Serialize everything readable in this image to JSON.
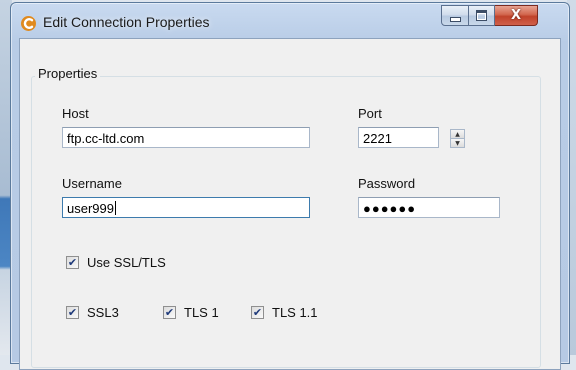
{
  "window": {
    "title": "Edit Connection Properties",
    "app_icon": "app-logo-icon",
    "buttons": {
      "minimize": "minimize-icon",
      "maximize": "maximize-icon",
      "close": "close-icon"
    },
    "close_glyph": "X"
  },
  "group": {
    "legend": "Properties"
  },
  "host": {
    "label": "Host",
    "value": "ftp.cc-ltd.com"
  },
  "port": {
    "label": "Port",
    "value": "2221",
    "up": "▲",
    "down": "▼"
  },
  "username": {
    "label": "Username",
    "value": "user999"
  },
  "password": {
    "label": "Password",
    "masked": "●●●●●●"
  },
  "options": {
    "use_ssl": {
      "label": "Use SSL/TLS",
      "checked": true
    },
    "ssl3": {
      "label": "SSL3",
      "checked": true
    },
    "tls1": {
      "label": "TLS 1",
      "checked": true
    },
    "tls11": {
      "label": "TLS 1.1",
      "checked": true
    }
  },
  "tick_glyph": "✔",
  "colors": {
    "close_button": "#c0422a",
    "title_bar": "#c9daf0",
    "focus_border": "#3d7bad"
  }
}
